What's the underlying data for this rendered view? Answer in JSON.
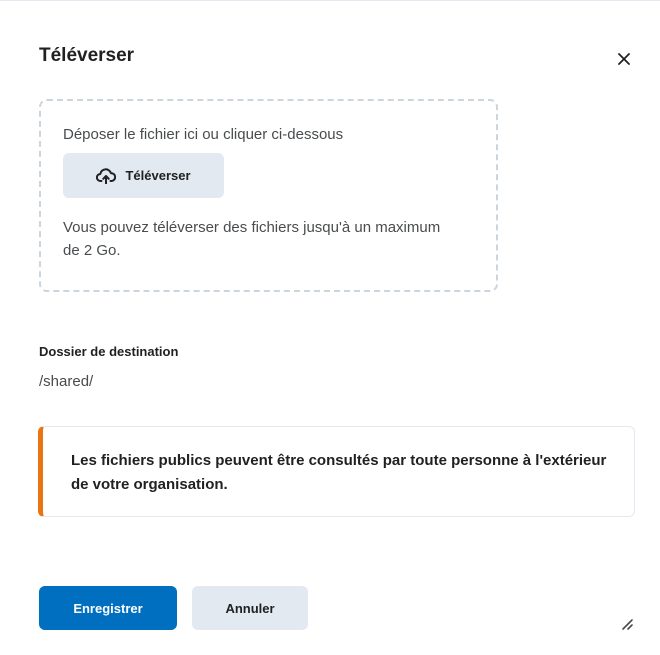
{
  "dialog": {
    "title": "Téléverser",
    "close_icon": "close-icon"
  },
  "dropzone": {
    "label": "Déposer le fichier ici ou cliquer ci-dessous",
    "upload_button_label": "Téléverser",
    "upload_icon": "cloud-upload-icon",
    "limit_text": "Vous pouvez téléverser des fichiers jusqu'à un maximum de 2 Go."
  },
  "destination": {
    "label": "Dossier de destination",
    "value": "/shared/"
  },
  "alert": {
    "text": "Les fichiers publics peuvent être consultés par toute personne à l'extérieur de votre organisation.",
    "accent_color": "#e87511"
  },
  "footer": {
    "save_label": "Enregistrer",
    "cancel_label": "Annuler",
    "resize_icon": "resize-handle-icon",
    "primary_color": "#006fbf"
  }
}
